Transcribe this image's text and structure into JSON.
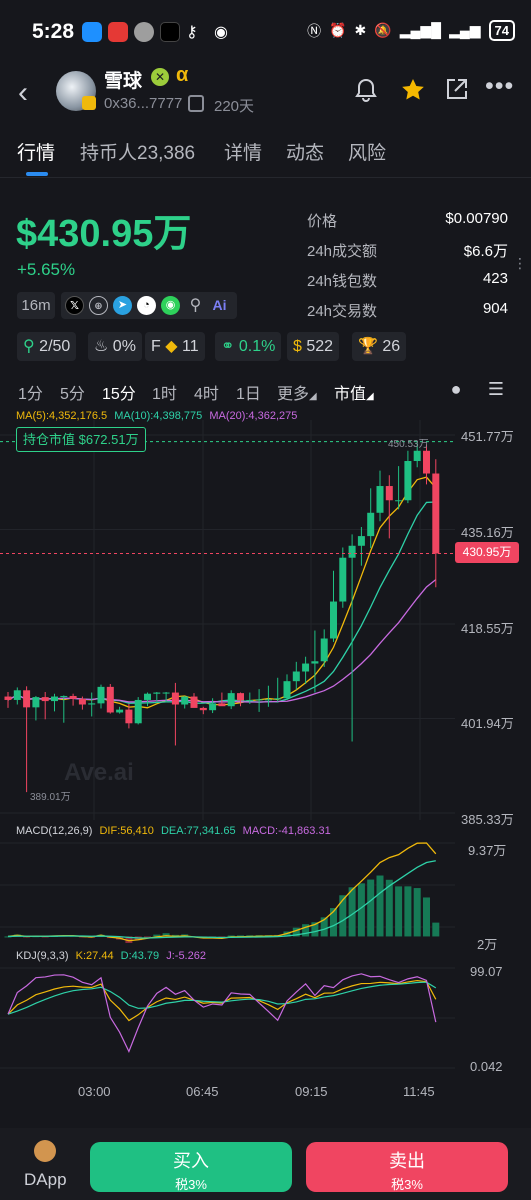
{
  "status_bar": {
    "time": "5:28",
    "battery": "74"
  },
  "header": {
    "coin_name": "雪球",
    "coin_alpha": "α",
    "address": "0x36...7777",
    "age": "220天",
    "icons": [
      "back-icon",
      "bell-icon",
      "star-icon",
      "share-icon",
      "more-icon"
    ],
    "star_color": "#f5b800"
  },
  "tabs": [
    "行情",
    "持币人23,386",
    "详情",
    "动态",
    "风险"
  ],
  "market_cap": "$430.95万",
  "change_pct": "+5.65%",
  "stats": [
    {
      "label": "价格",
      "value": "$0.00790"
    },
    {
      "label": "24h成交额",
      "value": "$6.6万"
    },
    {
      "label": "24h钱包数",
      "value": "423"
    },
    {
      "label": "24h交易数",
      "value": "904"
    }
  ],
  "age_chip": "16m",
  "socials": [
    "x-icon",
    "globe-icon",
    "telegram-icon",
    "qq-icon",
    "wechat-icon",
    "search-icon",
    "ai-icon"
  ],
  "badges": {
    "dev_holders": "2/50",
    "chef_pct": "0%",
    "f_label": "F",
    "four_count": "11",
    "bundle_pct": "0.1%",
    "money_count": "522",
    "trophy_count": "26"
  },
  "timeframes": [
    "1分",
    "5分",
    "15分",
    "1时",
    "4时",
    "1日",
    "更多",
    "市值"
  ],
  "active_timeframe": "15分",
  "ma_indicators": {
    "ma5": "MA(5):4,352,176.5",
    "ma10": "MA(10):4,398,775",
    "ma20": "MA(20):4,362,275"
  },
  "hold_value": "持仓市值 $672.51万",
  "watermark": "Ave.ai",
  "chart_data": [
    {
      "type": "candlestick",
      "title": "",
      "ylim": [
        385.33,
        451.77
      ],
      "y_unit": "万",
      "y_ticks": [
        "451.77万",
        "435.16万",
        "418.55万",
        "401.94万",
        "385.33万"
      ],
      "current_price_label": "430.95万",
      "high_label": "450.53万",
      "low_label": "389.01万",
      "x_ticks": [
        "03:00",
        "06:45",
        "09:15",
        "11:45"
      ],
      "candles": [
        [
          405.8,
          406.6,
          403.8,
          405.2
        ],
        [
          405.2,
          407.4,
          404.4,
          406.9
        ],
        [
          406.9,
          407.6,
          389.0,
          403.9
        ],
        [
          403.9,
          405.9,
          401.6,
          405.7
        ],
        [
          405.7,
          406.6,
          401.8,
          405.0
        ],
        [
          405.0,
          406.3,
          403.2,
          405.8
        ],
        [
          405.8,
          406.0,
          401.2,
          405.9
        ],
        [
          405.9,
          406.3,
          404.2,
          405.4
        ],
        [
          405.4,
          405.8,
          403.5,
          404.4
        ],
        [
          404.4,
          406.5,
          402.3,
          404.6
        ],
        [
          404.6,
          407.9,
          403.7,
          407.5
        ],
        [
          407.5,
          408.0,
          402.8,
          403.0
        ],
        [
          403.0,
          404.0,
          402.8,
          403.5
        ],
        [
          403.5,
          404.5,
          400.2,
          401.1
        ],
        [
          401.1,
          405.7,
          400.9,
          405.2
        ],
        [
          405.2,
          406.5,
          404.1,
          406.3
        ],
        [
          406.3,
          406.6,
          404.7,
          406.5
        ],
        [
          406.5,
          406.6,
          404.8,
          406.5
        ],
        [
          406.5,
          408.2,
          397.2,
          404.4
        ],
        [
          404.4,
          405.9,
          403.7,
          405.8
        ],
        [
          405.8,
          406.4,
          404.1,
          403.8
        ],
        [
          403.8,
          404.0,
          402.7,
          403.4
        ],
        [
          403.4,
          405.5,
          402.9,
          404.6
        ],
        [
          404.6,
          406.5,
          404.5,
          404.1
        ],
        [
          404.1,
          406.9,
          403.6,
          406.4
        ],
        [
          406.4,
          406.5,
          404.1,
          405.1
        ],
        [
          405.1,
          406.5,
          404.5,
          405.2
        ],
        [
          405.2,
          407.1,
          403.1,
          405.3
        ],
        [
          405.3,
          407.7,
          404.0,
          405.3
        ],
        [
          405.3,
          409.1,
          404.9,
          405.5
        ],
        [
          405.5,
          409.7,
          405.2,
          408.5
        ],
        [
          408.5,
          411.9,
          407.0,
          410.2
        ],
        [
          410.2,
          412.8,
          408.0,
          411.6
        ],
        [
          411.6,
          417.4,
          406.5,
          412.0
        ],
        [
          412.0,
          417.6,
          411.0,
          416.0
        ],
        [
          416.0,
          427.9,
          415.4,
          422.5
        ],
        [
          422.5,
          432.0,
          421.4,
          430.2
        ],
        [
          430.2,
          434.3,
          397.9,
          432.3
        ],
        [
          432.3,
          435.6,
          428.8,
          434.0
        ],
        [
          434.0,
          442.4,
          431.9,
          438.1
        ],
        [
          438.1,
          445.5,
          436.6,
          442.8
        ],
        [
          442.8,
          444.7,
          433.6,
          440.3
        ],
        [
          440.3,
          446.3,
          438.7,
          440.3
        ],
        [
          440.3,
          449.0,
          439.8,
          447.2
        ],
        [
          447.2,
          450.5,
          446.1,
          449.0
        ],
        [
          449.0,
          450.1,
          443.1,
          445.0
        ],
        [
          445.0,
          447.5,
          425.0,
          430.95
        ]
      ],
      "ma5_color": "#f0b90b",
      "ma10_color": "#2ed1a8",
      "ma20_color": "#c86ae0"
    },
    {
      "type": "bar",
      "title": "MACD(12,26,9)",
      "dif": "DIF:56,410",
      "dea": "DEA:77,341.65",
      "macd": "MACD:-41,863.31",
      "y_ticks": [
        "9.37万",
        "2万"
      ]
    },
    {
      "type": "line",
      "title": "KDJ(9,3,3)",
      "k": "K:27.44",
      "d": "D:43.79",
      "j": "J:-5.262",
      "y_ticks": [
        "99.07",
        "0.042"
      ]
    }
  ],
  "bottom_bar": {
    "dapp": "DApp",
    "buy": "买入",
    "buy_tax": "税3%",
    "sell": "卖出",
    "sell_tax": "税3%"
  }
}
